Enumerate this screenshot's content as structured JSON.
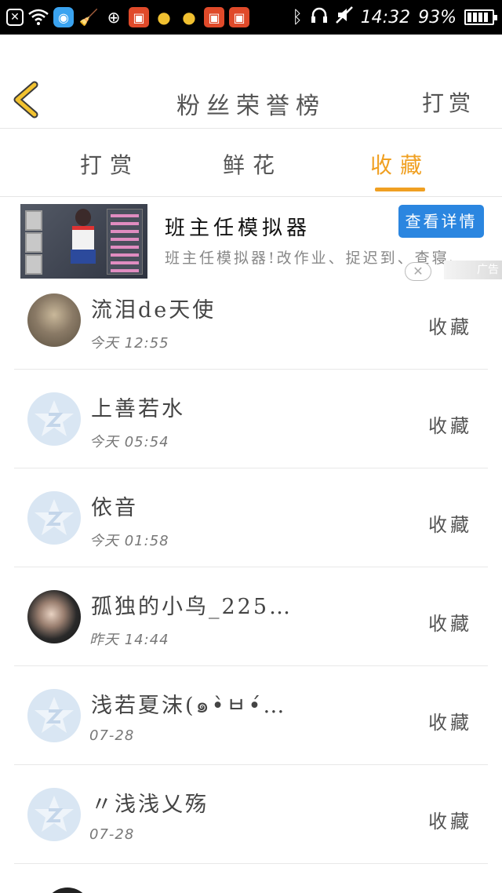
{
  "status_bar": {
    "time": "14:32",
    "battery_percent": "93%",
    "battery_level": 0.93,
    "icons": [
      "close-box-icon",
      "wifi-icon",
      "app-blue-icon",
      "broom-icon",
      "gps-icon",
      "app-red-icon",
      "lightbulb-icon",
      "lightbulb-icon",
      "app-red-icon",
      "app-red-icon",
      "bluetooth-icon",
      "headphones-icon",
      "silent-icon"
    ]
  },
  "header": {
    "title": "粉丝荣誉榜",
    "right_action": "打赏",
    "back_icon": "chevron-left-icon",
    "accent_color": "#f0a022"
  },
  "tabs": [
    {
      "label": "打赏",
      "active": false
    },
    {
      "label": "鲜花",
      "active": false
    },
    {
      "label": "收藏",
      "active": true
    }
  ],
  "ad": {
    "title": "班主任模拟器",
    "description": "班主任模拟器!改作业、捉迟到、查寝、",
    "cta": "查看详情",
    "close": "✕",
    "tag": "广告",
    "cta_color": "#2b86e0"
  },
  "list": [
    {
      "name": "流泪de天使",
      "time": "今天 12:55",
      "action": "收藏",
      "avatar": "photo"
    },
    {
      "name": "上善若水",
      "time": "今天 05:54",
      "action": "收藏",
      "avatar": "qq-default"
    },
    {
      "name": "依音",
      "time": "今天 01:58",
      "action": "收藏",
      "avatar": "qq-default"
    },
    {
      "name": "孤独的小鸟_225…",
      "time": "昨天 14:44",
      "action": "收藏",
      "avatar": "photo"
    },
    {
      "name": "浅若夏沫(๑•̀ㅂ•́…",
      "time": "07-28",
      "action": "收藏",
      "avatar": "qq-default"
    },
    {
      "name": "〃浅浅乂殇",
      "time": "07-28",
      "action": "收藏",
      "avatar": "qq-default"
    }
  ]
}
